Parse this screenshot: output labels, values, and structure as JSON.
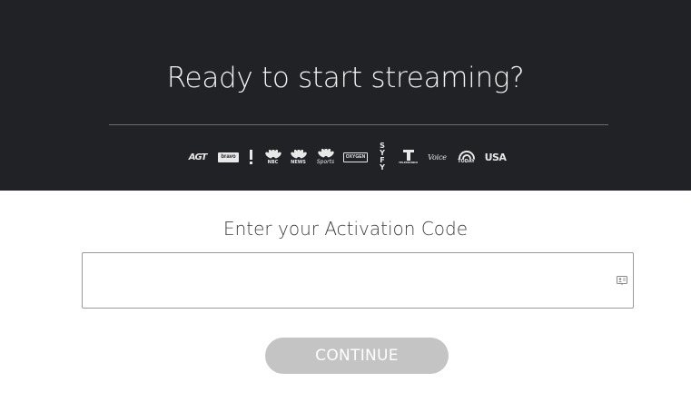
{
  "hero": {
    "title": "Ready to start streaming?",
    "logos": [
      {
        "icon": "agt-logo",
        "label": "AGT"
      },
      {
        "icon": "bravo-logo",
        "label": "bravo"
      },
      {
        "icon": "e-logo",
        "label": "E!"
      },
      {
        "icon": "nbc-logo",
        "label": "NBC"
      },
      {
        "icon": "nbc-news-logo",
        "label": "NEWS"
      },
      {
        "icon": "nbc-sports-logo",
        "label": "Sports"
      },
      {
        "icon": "oxygen-logo",
        "label": "OXYGEN"
      },
      {
        "icon": "syfy-logo",
        "label": "SY FY"
      },
      {
        "icon": "telemundo-logo",
        "label": "TELEMUNDO"
      },
      {
        "icon": "the-voice-logo",
        "label": "Voice"
      },
      {
        "icon": "today-logo",
        "label": "TODAY"
      },
      {
        "icon": "usa-logo",
        "label": "USA"
      }
    ]
  },
  "activation": {
    "label": "Enter your Activation Code",
    "code_value": "",
    "code_placeholder": ""
  },
  "continue_button": {
    "label": "CONTINUE"
  },
  "colors": {
    "hero_bg": "#212226",
    "button_disabled": "#c4c4c4"
  }
}
